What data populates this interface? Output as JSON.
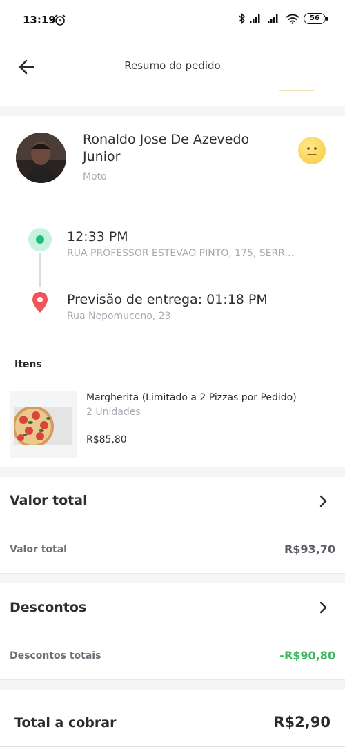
{
  "status_bar": {
    "time": "13:19",
    "battery": "56"
  },
  "header": {
    "title": "Resumo do pedido"
  },
  "courier": {
    "name": "Ronaldo Jose De Azevedo Junior",
    "vehicle": "Moto"
  },
  "timeline": {
    "origin": {
      "time": "12:33 PM",
      "address": "RUA PROFESSOR ESTEVAO PINTO, 175, SERR..."
    },
    "destination": {
      "title": "Previsão de entrega: 01:18 PM",
      "address": "Rua Nepomuceno, 23"
    }
  },
  "items": {
    "header": "Itens",
    "list": [
      {
        "name": "Margherita (Limitado a 2 Pizzas por Pedido)",
        "quantity": "2 Unidades",
        "price": "R$85,80"
      }
    ]
  },
  "total_section": {
    "title": "Valor total",
    "label": "Valor total",
    "value": "R$93,70"
  },
  "discount_section": {
    "title": "Descontos",
    "label": "Descontos totais",
    "value": "-R$90,80"
  },
  "grand_total": {
    "label": "Total a cobrar",
    "value": "R$2,90"
  },
  "colors": {
    "accent_green": "#20c07a",
    "discount_green": "#3cb860",
    "pin_red": "#f0555a"
  }
}
